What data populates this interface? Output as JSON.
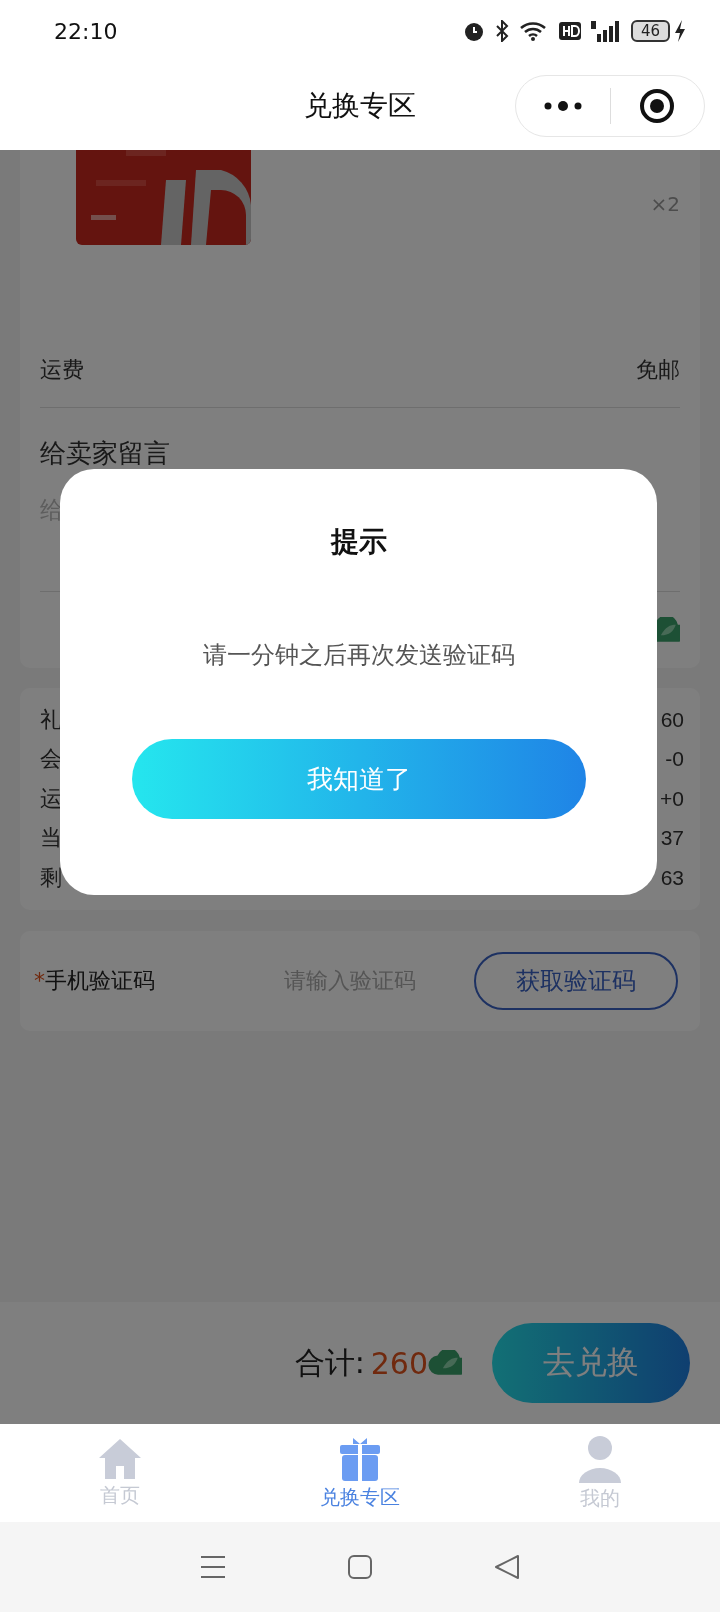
{
  "status_bar": {
    "time": "22:10",
    "battery": "46"
  },
  "nav_bar": {
    "title": "兑换专区"
  },
  "product": {
    "kind": "picture",
    "quantity": "×2"
  },
  "shipping": {
    "label": "运费",
    "value": "免邮"
  },
  "message": {
    "label": "给卖家留言",
    "placeholder": "给"
  },
  "summary_rows": [
    {
      "label": "礼",
      "value": "60"
    },
    {
      "label": "会",
      "value": "-0"
    },
    {
      "label": "运",
      "value": "+0"
    },
    {
      "label": "当",
      "value": "37"
    },
    {
      "label": "剩",
      "value": "63"
    }
  ],
  "verification": {
    "required_mark": "*",
    "label": "手机验证码",
    "placeholder": "请输入验证码",
    "button": "获取验证码"
  },
  "footer": {
    "total_label": "合计:",
    "total_value": "260",
    "button": "去兑换"
  },
  "dialog": {
    "title": "提示",
    "message": "请一分钟之后再次发送验证码",
    "button": "我知道了"
  },
  "tabs": [
    {
      "kind": "home",
      "label": "首页",
      "selected": false
    },
    {
      "kind": "gift",
      "label": "兑换专区",
      "selected": true
    },
    {
      "kind": "person",
      "label": "我的",
      "selected": false
    }
  ]
}
